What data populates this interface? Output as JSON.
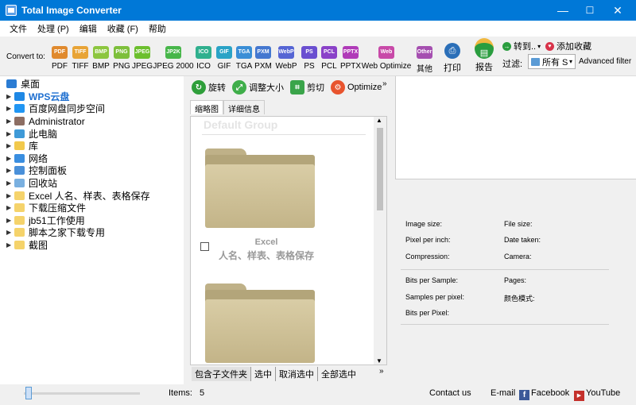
{
  "window": {
    "title": "Total Image Converter",
    "min": "—",
    "max": "☐",
    "close": "✕"
  },
  "menu": [
    "文件",
    "处理 (P)",
    "编辑",
    "收藏 (F)",
    "帮助"
  ],
  "toolbar": {
    "convert_to": "Convert to:",
    "formats": [
      {
        "label": "PDF",
        "icon": "PDF",
        "color": "#e08a2e"
      },
      {
        "label": "TIFF",
        "icon": "TIFF",
        "color": "#e8a436"
      },
      {
        "label": "BMP",
        "icon": "BMP",
        "color": "#8cc63f"
      },
      {
        "label": "PNG",
        "icon": "PNG",
        "color": "#7dbf3b"
      },
      {
        "label": "JPEG",
        "icon": "JPEG",
        "color": "#6cbf2e"
      },
      {
        "label": "JPEG 2000",
        "icon": "JP2K",
        "color": "#47b64a"
      },
      {
        "label": "ICO",
        "icon": "ICO",
        "color": "#30b08e"
      },
      {
        "label": "GIF",
        "icon": "GIF",
        "color": "#2aa3c6"
      },
      {
        "label": "TGA",
        "icon": "TGA",
        "color": "#3a8ed6"
      },
      {
        "label": "PXM",
        "icon": "PXM",
        "color": "#4478d0"
      },
      {
        "label": "WebP",
        "icon": "WebP",
        "color": "#5565d4"
      },
      {
        "label": "PS",
        "icon": "PS",
        "color": "#6a4fd0"
      },
      {
        "label": "PCL",
        "icon": "PCL",
        "color": "#8a42c8"
      },
      {
        "label": "PPTX",
        "icon": "PPTX",
        "color": "#b03bb8"
      },
      {
        "label": "Web Optimize",
        "icon": "Web",
        "color": "#c84aa8"
      },
      {
        "label": "其他",
        "icon": "Other",
        "color": "#a54fb0"
      }
    ],
    "print": "打印",
    "report": "报告",
    "goto": "转到..",
    "add_fav": "添加收藏",
    "filter_label": "过滤:",
    "filter_value": "所有 S",
    "advanced": "Advanced filter"
  },
  "tree": [
    {
      "label": "桌面",
      "color": "#2b7cd3",
      "root": true
    },
    {
      "label": "WPS云盘",
      "color": "#1e88e5",
      "bold": true
    },
    {
      "label": "百度网盘同步空间",
      "color": "#2196f3"
    },
    {
      "label": "Administrator",
      "color": "#8d6e63"
    },
    {
      "label": "此电脑",
      "color": "#3f9ad8"
    },
    {
      "label": "库",
      "color": "#f2c94c"
    },
    {
      "label": "网络",
      "color": "#3a8ee0"
    },
    {
      "label": "控制面板",
      "color": "#4a90d9"
    },
    {
      "label": "回收站",
      "color": "#7ab0e0"
    },
    {
      "label": "Excel 人名、样表、表格保存",
      "color": "#f5d36b"
    },
    {
      "label": "下载压缩文件",
      "color": "#f5d36b"
    },
    {
      "label": "jb51工作使用",
      "color": "#f5d36b"
    },
    {
      "label": "脚本之家下载专用",
      "color": "#f5d36b"
    },
    {
      "label": "截图",
      "color": "#f5d36b"
    }
  ],
  "actions": [
    {
      "label": "旋转",
      "color": "#2e9e3a"
    },
    {
      "label": "调整大小",
      "color": "#3fae4a"
    },
    {
      "label": "剪切",
      "color": "#3aa44a"
    },
    {
      "label": "Optimize",
      "color": "#e8542e"
    }
  ],
  "tabs": [
    "缩略图",
    "详细信息"
  ],
  "thumbs": {
    "group": "Default Group",
    "item1_line1": "Excel",
    "item1_line2": "人名、样表、表格保存"
  },
  "bottom_actions": [
    "包含子文件夹",
    "选中",
    "取消选中",
    "全部选中"
  ],
  "info": {
    "image_size": "Image size:",
    "file_size": "File size:",
    "ppi": "Pixel per inch:",
    "date_taken": "Date taken:",
    "compression": "Compression:",
    "camera": "Camera:",
    "bps": "Bits per Sample:",
    "pages": "Pages:",
    "spp": "Samples per pixel:",
    "color_mode": "颜色模式:",
    "bpp": "Bits per Pixel:"
  },
  "status": {
    "items_label": "Items:",
    "items_count": "5",
    "contact": "Contact us",
    "email": "E-mail",
    "facebook": "Facebook",
    "youtube": "YouTube"
  }
}
